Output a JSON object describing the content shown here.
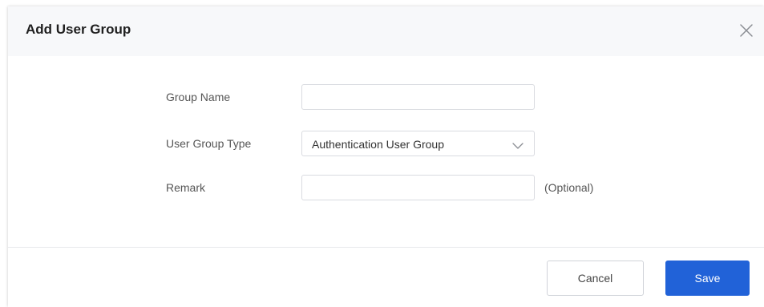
{
  "dialog": {
    "title": "Add User Group",
    "close_icon": "close-icon"
  },
  "form": {
    "group_name": {
      "label": "Group Name",
      "value": "",
      "placeholder": ""
    },
    "user_group_type": {
      "label": "User Group Type",
      "selected": "Authentication User Group",
      "icon": "chevron-down-icon"
    },
    "remark": {
      "label": "Remark",
      "value": "",
      "placeholder": "",
      "hint": "(Optional)"
    }
  },
  "footer": {
    "cancel_label": "Cancel",
    "save_label": "Save"
  },
  "colors": {
    "header_bg": "#f7f8fa",
    "primary": "#2162d8",
    "border": "#d9dbe0",
    "text": "#333333"
  }
}
